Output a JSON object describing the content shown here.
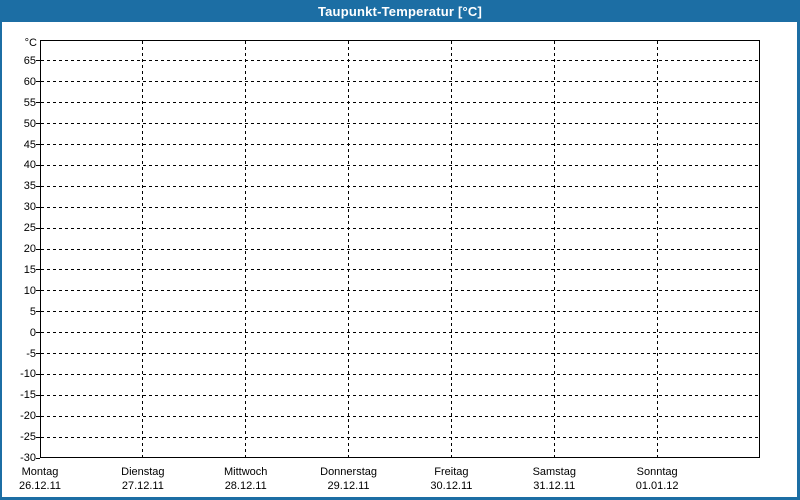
{
  "window": {
    "title": "Taupunkt-Temperatur [°C]",
    "colors": {
      "titlebar": "#1C6EA4",
      "frame": "#1C6EA4",
      "background": "#FFFFFF",
      "plot_border": "#000000",
      "grid": "#000000",
      "text": "#000000",
      "title_text": "#FFFFFF"
    }
  },
  "chart_data": {
    "type": "line",
    "title": "Taupunkt-Temperatur [°C]",
    "ylabel": "°C",
    "y_axis": {
      "unit": "°C",
      "min": -30,
      "max": 70,
      "tick_step": 5,
      "ticks": [
        65,
        60,
        55,
        50,
        45,
        40,
        35,
        30,
        25,
        20,
        15,
        10,
        5,
        0,
        -5,
        -10,
        -15,
        -20,
        -25,
        -30
      ]
    },
    "x_axis": {
      "intervals": 7,
      "days": [
        {
          "name": "Montag",
          "date": "26.12.11"
        },
        {
          "name": "Dienstag",
          "date": "27.12.11"
        },
        {
          "name": "Mittwoch",
          "date": "28.12.11"
        },
        {
          "name": "Donnerstag",
          "date": "29.12.11"
        },
        {
          "name": "Freitag",
          "date": "30.12.11"
        },
        {
          "name": "Samstag",
          "date": "31.12.11"
        },
        {
          "name": "Sonntag",
          "date": "01.01.12"
        }
      ]
    },
    "series": [],
    "grid": {
      "style": "dashed",
      "horizontal": true,
      "vertical": true
    },
    "legend": "none"
  }
}
